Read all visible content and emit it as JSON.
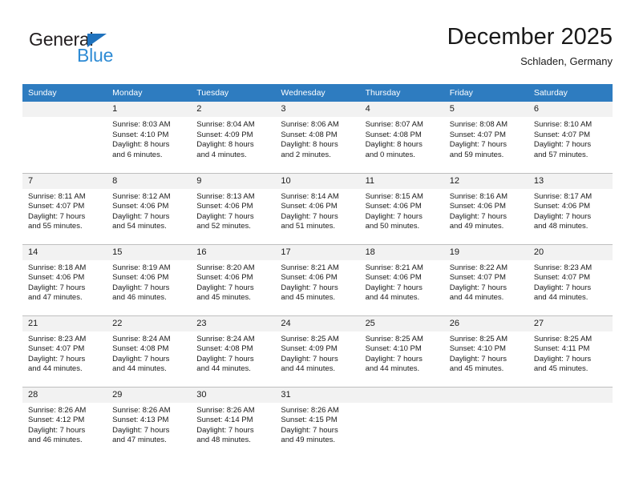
{
  "brand": {
    "name_top": "General",
    "name_bottom": "Blue",
    "triangle_color": "#1f72bd",
    "blue_color": "#2e8bd4"
  },
  "header": {
    "title": "December 2025",
    "subtitle": "Schladen, Germany"
  },
  "colors": {
    "header_row_bg": "#2e7cc0",
    "header_row_text": "#ffffff",
    "daynum_bg": "#f2f2f2",
    "row_divider": "#bfbfbf",
    "page_bg": "#ffffff",
    "text": "#1a1a1a"
  },
  "weekdays": [
    "Sunday",
    "Monday",
    "Tuesday",
    "Wednesday",
    "Thursday",
    "Friday",
    "Saturday"
  ],
  "weeks": [
    [
      {
        "day": "",
        "lines": []
      },
      {
        "day": "1",
        "lines": [
          "Sunrise: 8:03 AM",
          "Sunset: 4:10 PM",
          "Daylight: 8 hours",
          "and 6 minutes."
        ]
      },
      {
        "day": "2",
        "lines": [
          "Sunrise: 8:04 AM",
          "Sunset: 4:09 PM",
          "Daylight: 8 hours",
          "and 4 minutes."
        ]
      },
      {
        "day": "3",
        "lines": [
          "Sunrise: 8:06 AM",
          "Sunset: 4:08 PM",
          "Daylight: 8 hours",
          "and 2 minutes."
        ]
      },
      {
        "day": "4",
        "lines": [
          "Sunrise: 8:07 AM",
          "Sunset: 4:08 PM",
          "Daylight: 8 hours",
          "and 0 minutes."
        ]
      },
      {
        "day": "5",
        "lines": [
          "Sunrise: 8:08 AM",
          "Sunset: 4:07 PM",
          "Daylight: 7 hours",
          "and 59 minutes."
        ]
      },
      {
        "day": "6",
        "lines": [
          "Sunrise: 8:10 AM",
          "Sunset: 4:07 PM",
          "Daylight: 7 hours",
          "and 57 minutes."
        ]
      }
    ],
    [
      {
        "day": "7",
        "lines": [
          "Sunrise: 8:11 AM",
          "Sunset: 4:07 PM",
          "Daylight: 7 hours",
          "and 55 minutes."
        ]
      },
      {
        "day": "8",
        "lines": [
          "Sunrise: 8:12 AM",
          "Sunset: 4:06 PM",
          "Daylight: 7 hours",
          "and 54 minutes."
        ]
      },
      {
        "day": "9",
        "lines": [
          "Sunrise: 8:13 AM",
          "Sunset: 4:06 PM",
          "Daylight: 7 hours",
          "and 52 minutes."
        ]
      },
      {
        "day": "10",
        "lines": [
          "Sunrise: 8:14 AM",
          "Sunset: 4:06 PM",
          "Daylight: 7 hours",
          "and 51 minutes."
        ]
      },
      {
        "day": "11",
        "lines": [
          "Sunrise: 8:15 AM",
          "Sunset: 4:06 PM",
          "Daylight: 7 hours",
          "and 50 minutes."
        ]
      },
      {
        "day": "12",
        "lines": [
          "Sunrise: 8:16 AM",
          "Sunset: 4:06 PM",
          "Daylight: 7 hours",
          "and 49 minutes."
        ]
      },
      {
        "day": "13",
        "lines": [
          "Sunrise: 8:17 AM",
          "Sunset: 4:06 PM",
          "Daylight: 7 hours",
          "and 48 minutes."
        ]
      }
    ],
    [
      {
        "day": "14",
        "lines": [
          "Sunrise: 8:18 AM",
          "Sunset: 4:06 PM",
          "Daylight: 7 hours",
          "and 47 minutes."
        ]
      },
      {
        "day": "15",
        "lines": [
          "Sunrise: 8:19 AM",
          "Sunset: 4:06 PM",
          "Daylight: 7 hours",
          "and 46 minutes."
        ]
      },
      {
        "day": "16",
        "lines": [
          "Sunrise: 8:20 AM",
          "Sunset: 4:06 PM",
          "Daylight: 7 hours",
          "and 45 minutes."
        ]
      },
      {
        "day": "17",
        "lines": [
          "Sunrise: 8:21 AM",
          "Sunset: 4:06 PM",
          "Daylight: 7 hours",
          "and 45 minutes."
        ]
      },
      {
        "day": "18",
        "lines": [
          "Sunrise: 8:21 AM",
          "Sunset: 4:06 PM",
          "Daylight: 7 hours",
          "and 44 minutes."
        ]
      },
      {
        "day": "19",
        "lines": [
          "Sunrise: 8:22 AM",
          "Sunset: 4:07 PM",
          "Daylight: 7 hours",
          "and 44 minutes."
        ]
      },
      {
        "day": "20",
        "lines": [
          "Sunrise: 8:23 AM",
          "Sunset: 4:07 PM",
          "Daylight: 7 hours",
          "and 44 minutes."
        ]
      }
    ],
    [
      {
        "day": "21",
        "lines": [
          "Sunrise: 8:23 AM",
          "Sunset: 4:07 PM",
          "Daylight: 7 hours",
          "and 44 minutes."
        ]
      },
      {
        "day": "22",
        "lines": [
          "Sunrise: 8:24 AM",
          "Sunset: 4:08 PM",
          "Daylight: 7 hours",
          "and 44 minutes."
        ]
      },
      {
        "day": "23",
        "lines": [
          "Sunrise: 8:24 AM",
          "Sunset: 4:08 PM",
          "Daylight: 7 hours",
          "and 44 minutes."
        ]
      },
      {
        "day": "24",
        "lines": [
          "Sunrise: 8:25 AM",
          "Sunset: 4:09 PM",
          "Daylight: 7 hours",
          "and 44 minutes."
        ]
      },
      {
        "day": "25",
        "lines": [
          "Sunrise: 8:25 AM",
          "Sunset: 4:10 PM",
          "Daylight: 7 hours",
          "and 44 minutes."
        ]
      },
      {
        "day": "26",
        "lines": [
          "Sunrise: 8:25 AM",
          "Sunset: 4:10 PM",
          "Daylight: 7 hours",
          "and 45 minutes."
        ]
      },
      {
        "day": "27",
        "lines": [
          "Sunrise: 8:25 AM",
          "Sunset: 4:11 PM",
          "Daylight: 7 hours",
          "and 45 minutes."
        ]
      }
    ],
    [
      {
        "day": "28",
        "lines": [
          "Sunrise: 8:26 AM",
          "Sunset: 4:12 PM",
          "Daylight: 7 hours",
          "and 46 minutes."
        ]
      },
      {
        "day": "29",
        "lines": [
          "Sunrise: 8:26 AM",
          "Sunset: 4:13 PM",
          "Daylight: 7 hours",
          "and 47 minutes."
        ]
      },
      {
        "day": "30",
        "lines": [
          "Sunrise: 8:26 AM",
          "Sunset: 4:14 PM",
          "Daylight: 7 hours",
          "and 48 minutes."
        ]
      },
      {
        "day": "31",
        "lines": [
          "Sunrise: 8:26 AM",
          "Sunset: 4:15 PM",
          "Daylight: 7 hours",
          "and 49 minutes."
        ]
      },
      {
        "day": "",
        "lines": []
      },
      {
        "day": "",
        "lines": []
      },
      {
        "day": "",
        "lines": []
      }
    ]
  ]
}
